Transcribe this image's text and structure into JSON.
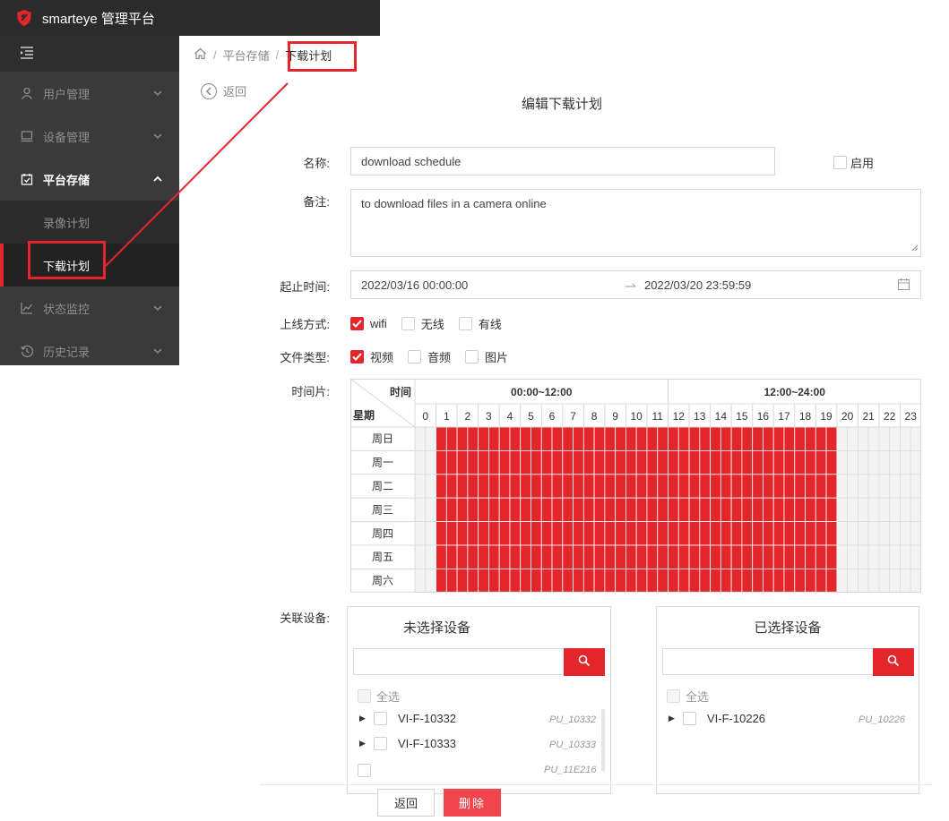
{
  "app": {
    "title": "smarteye 管理平台"
  },
  "sidebar": {
    "items": [
      {
        "label": "用户管理",
        "icon": "user-icon"
      },
      {
        "label": "设备管理",
        "icon": "monitor-icon"
      },
      {
        "label": "平台存储",
        "icon": "calendar-check-icon"
      },
      {
        "label": "状态监控",
        "icon": "chart-line-icon"
      },
      {
        "label": "历史记录",
        "icon": "history-icon"
      }
    ],
    "sub_items": [
      {
        "label": "录像计划"
      },
      {
        "label": "下载计划"
      }
    ]
  },
  "breadcrumb": {
    "home_icon": "home-icon",
    "sep": "/",
    "level1": "平台存储",
    "current": "下载计划"
  },
  "back": {
    "label": "返回"
  },
  "form": {
    "title": "编辑下载计划",
    "name_label": "名称:",
    "name_value": "download schedule",
    "enable_label": "启用",
    "enabled": false,
    "remark_label": "备注:",
    "remark_value": "to download files in a camera online",
    "time_label": "起止时间:",
    "start_time": "2022/03/16 00:00:00",
    "end_time": "2022/03/20 23:59:59",
    "online_label": "上线方式:",
    "online_options": [
      {
        "label": "wifi",
        "checked": true
      },
      {
        "label": "无线",
        "checked": false
      },
      {
        "label": "有线",
        "checked": false
      }
    ],
    "filetype_label": "文件类型:",
    "filetype_options": [
      {
        "label": "视频",
        "checked": true
      },
      {
        "label": "音频",
        "checked": false
      },
      {
        "label": "图片",
        "checked": false
      }
    ],
    "timeslot_label": "时间片:",
    "device_label": "关联设备:"
  },
  "schedule": {
    "corner_top": "时间",
    "corner_bottom": "星期",
    "am_header": "00:00~12:00",
    "pm_header": "12:00~24:00",
    "hours": [
      "0",
      "1",
      "2",
      "3",
      "4",
      "5",
      "6",
      "7",
      "8",
      "9",
      "10",
      "11",
      "12",
      "13",
      "14",
      "15",
      "16",
      "17",
      "18",
      "19",
      "20",
      "21",
      "22",
      "23"
    ],
    "days": [
      "周日",
      "周一",
      "周二",
      "周三",
      "周四",
      "周五",
      "周六"
    ],
    "selected_from_hour": 1,
    "selected_to_hour": 20,
    "fill_color": "#e3262c"
  },
  "devices": {
    "unselected_title": "未选择设备",
    "selected_title": "已选择设备",
    "select_all": "全选",
    "unselected": [
      {
        "name": "VI-F-10332",
        "tag": "PU_10332"
      },
      {
        "name": "VI-F-10333",
        "tag": "PU_10333"
      },
      {
        "name": "",
        "tag": "PU_11E216"
      }
    ],
    "selected": [
      {
        "name": "VI-F-10226",
        "tag": "PU_10226"
      }
    ]
  },
  "actions": {
    "back": "返回",
    "delete": "删除"
  },
  "colors": {
    "accent": "#e3262c",
    "sidebar_bg": "#3a3a3a",
    "topbar_bg": "#2b2b2b"
  }
}
